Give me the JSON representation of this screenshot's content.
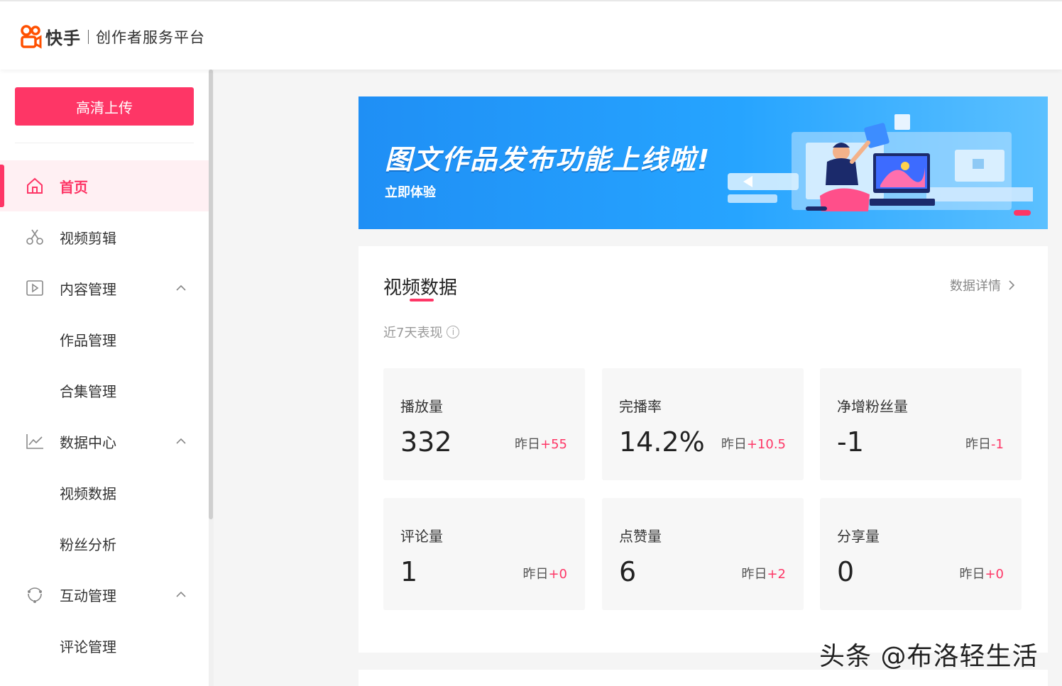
{
  "header": {
    "brand": "快手",
    "subtitle": "创作者服务平台"
  },
  "sidebar": {
    "upload_label": "高清上传",
    "items": [
      {
        "label": "首页",
        "icon": "home-icon",
        "active": true
      },
      {
        "label": "视频剪辑",
        "icon": "scissors-icon"
      },
      {
        "label": "内容管理",
        "icon": "play-box-icon",
        "expanded": true
      },
      {
        "label": "作品管理",
        "sub": true
      },
      {
        "label": "合集管理",
        "sub": true
      },
      {
        "label": "数据中心",
        "icon": "line-chart-icon",
        "expanded": true
      },
      {
        "label": "视频数据",
        "sub": true
      },
      {
        "label": "粉丝分析",
        "sub": true
      },
      {
        "label": "互动管理",
        "icon": "interaction-icon",
        "expanded": true
      },
      {
        "label": "评论管理",
        "sub": true
      }
    ]
  },
  "banner": {
    "title": "图文作品发布功能上线啦!",
    "subtitle": "立即体验"
  },
  "video_data": {
    "title": "视频数据",
    "detail_link": "数据详情",
    "period_note": "近7天表现",
    "yesterday_label": "昨日",
    "stats": [
      {
        "name": "播放量",
        "value": "332",
        "delta": "+55"
      },
      {
        "name": "完播率",
        "value": "14.2%",
        "delta": "+10.5"
      },
      {
        "name": "净增粉丝量",
        "value": "-1",
        "delta": "-1"
      },
      {
        "name": "评论量",
        "value": "1",
        "delta": "+0"
      },
      {
        "name": "点赞量",
        "value": "6",
        "delta": "+2"
      },
      {
        "name": "分享量",
        "value": "0",
        "delta": "+0"
      }
    ]
  },
  "watermark": "头条 @布洛轻生活",
  "colors": {
    "accent": "#fe3666",
    "banner": "#1f8ff5"
  }
}
